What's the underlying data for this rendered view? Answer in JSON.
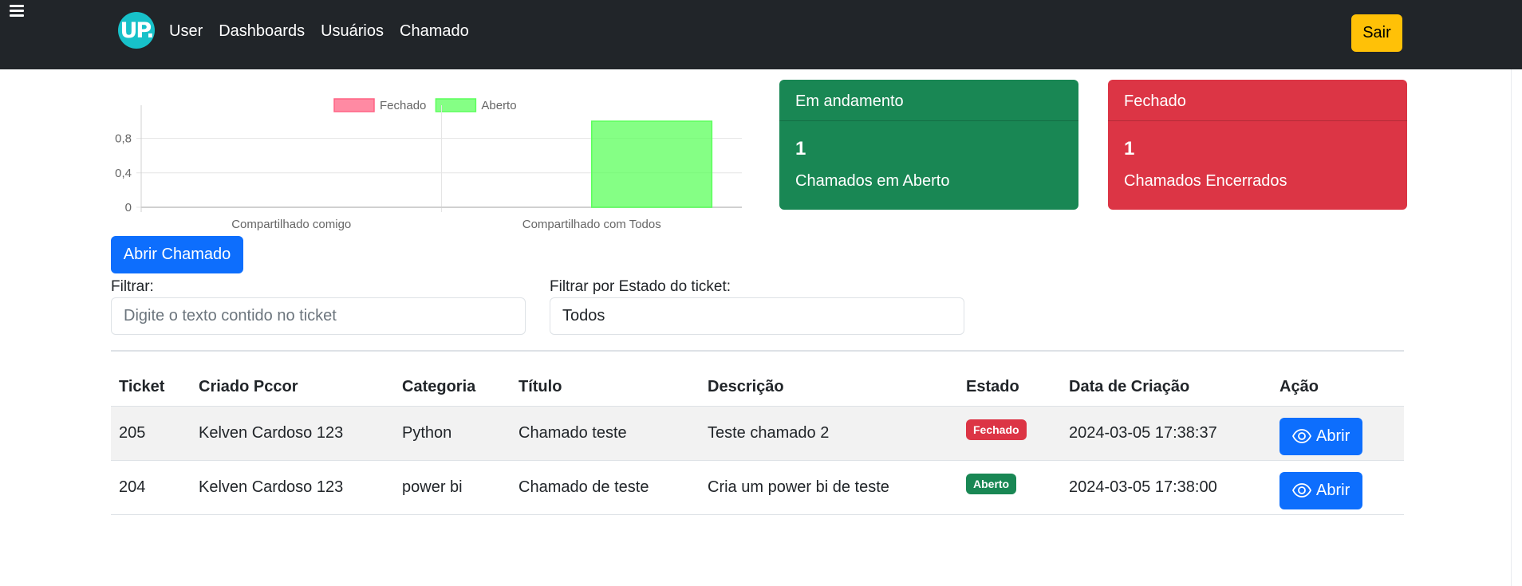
{
  "nav": {
    "logo_text": "UP.",
    "links": [
      "User",
      "Dashboards",
      "Usuários",
      "Chamado"
    ],
    "logout_label": "Sair"
  },
  "chart_data": {
    "type": "bar",
    "categories": [
      "Compartilhado comigo",
      "Compartilhado com Todos"
    ],
    "series": [
      {
        "name": "Fechado",
        "values": [
          0,
          0
        ],
        "color": "#ff6384"
      },
      {
        "name": "Aberto",
        "values": [
          0,
          1
        ],
        "color": "#5cff5c"
      }
    ],
    "yticks": [
      "0",
      "0,4",
      "0,8"
    ],
    "ylim": [
      0,
      1
    ],
    "legend": "top",
    "grid": true
  },
  "cards": {
    "in_progress": {
      "title": "Em andamento",
      "count": "1",
      "text": "Chamados em Aberto",
      "color": "#198754"
    },
    "closed": {
      "title": "Fechado",
      "count": "1",
      "text": "Chamados Encerrados",
      "color": "#dc3545"
    }
  },
  "actions": {
    "open_ticket_label": "Abrir Chamado"
  },
  "filters": {
    "text_label": "Filtrar:",
    "text_placeholder": "Digite o texto contido no ticket",
    "state_label": "Filtrar por Estado do ticket:",
    "state_value": "Todos"
  },
  "table": {
    "headers": [
      "Ticket",
      "Criado Pccor",
      "Categoria",
      "Título",
      "Descrição",
      "Estado",
      "Data de Criação",
      "Ação"
    ],
    "rows": [
      {
        "ticket": "205",
        "created_by": "Kelven Cardoso 123",
        "category": "Python",
        "title": "Chamado teste",
        "description": "Teste chamado 2",
        "state": "Fechado",
        "date": "2024-03-05 17:38:37",
        "action": "Abrir"
      },
      {
        "ticket": "204",
        "created_by": "Kelven Cardoso 123",
        "category": "power bi",
        "title": "Chamado de teste",
        "description": "Cria um power bi de teste",
        "state": "Aberto",
        "date": "2024-03-05 17:38:00",
        "action": "Abrir"
      }
    ]
  }
}
